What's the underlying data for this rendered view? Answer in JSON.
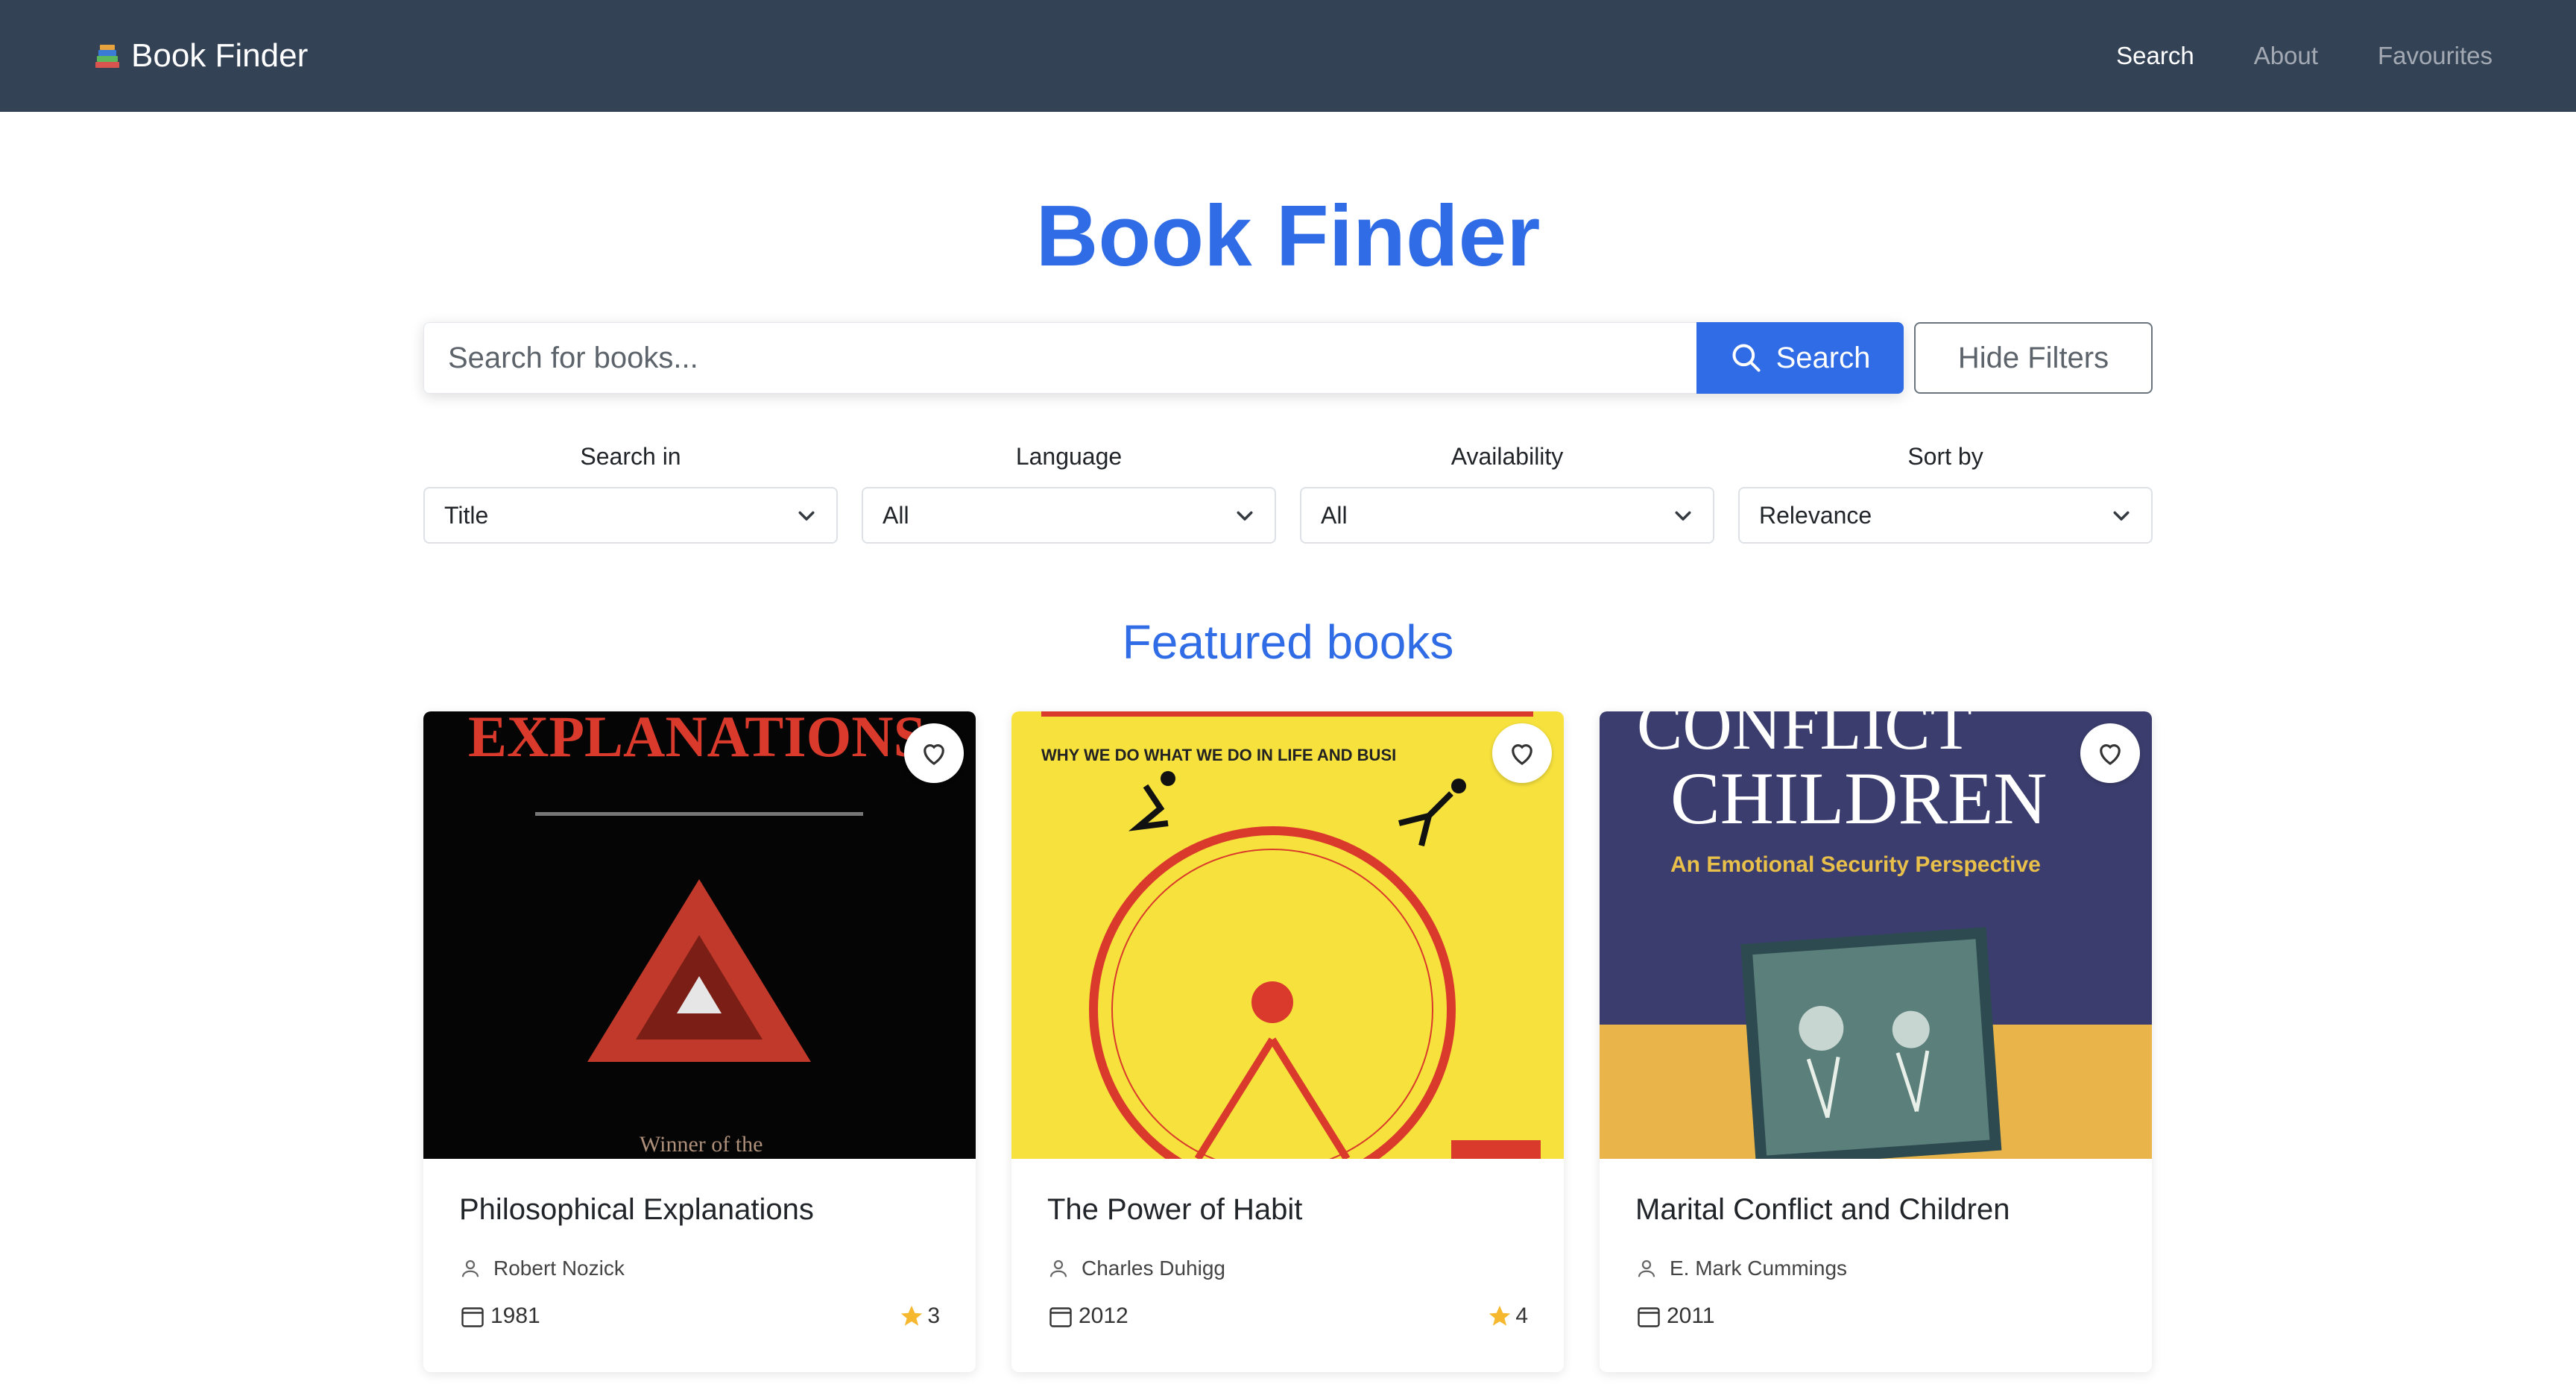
{
  "navbar": {
    "brand": "Book Finder",
    "links": [
      {
        "label": "Search",
        "active": true
      },
      {
        "label": "About",
        "active": false
      },
      {
        "label": "Favourites",
        "active": false
      }
    ]
  },
  "hero": {
    "title": "Book Finder"
  },
  "search": {
    "placeholder": "Search for books...",
    "button_label": "Search",
    "filters_toggle_label": "Hide Filters"
  },
  "filters": [
    {
      "label": "Search in",
      "value": "Title"
    },
    {
      "label": "Language",
      "value": "All"
    },
    {
      "label": "Availability",
      "value": "All"
    },
    {
      "label": "Sort by",
      "value": "Relevance"
    }
  ],
  "featured": {
    "title": "Featured books",
    "books": [
      {
        "title": "Philosophical Explanations",
        "author": "Robert Nozick",
        "year": "1981",
        "rating": "3",
        "cover_text": "EXPLANATIONS",
        "cover_subtext": "Winner of the"
      },
      {
        "title": "The Power of Habit",
        "author": "Charles Duhigg",
        "year": "2012",
        "rating": "4",
        "cover_text": "WHY WE DO     WHAT WE DO IN LIFE AND BUSI"
      },
      {
        "title": "Marital Conflict and Children",
        "author": "E. Mark Cummings",
        "year": "2011",
        "rating": "",
        "cover_text": "CONFLICT",
        "cover_text_2": "CHILDREN",
        "cover_subtext": "An Emotional Security Perspective"
      }
    ]
  },
  "colors": {
    "navbar": "#344256",
    "accent": "#2f6ce5",
    "star": "#f5b82e"
  }
}
